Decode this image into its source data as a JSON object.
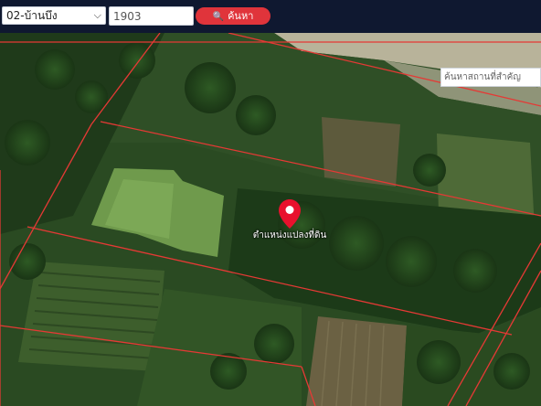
{
  "toolbar": {
    "district_select": "02-บ้านบึง",
    "parcel_value": "1903",
    "search_label": "ค้นหา"
  },
  "map": {
    "place_search_placeholder": "ค้นหาสถานที่สำคัญ",
    "marker_label": "ตำแหน่งแปลงที่ดิน",
    "marker_icon": "map-pin-icon",
    "parcel_line_color": "#e53935",
    "marker_color": "#e8112d"
  }
}
